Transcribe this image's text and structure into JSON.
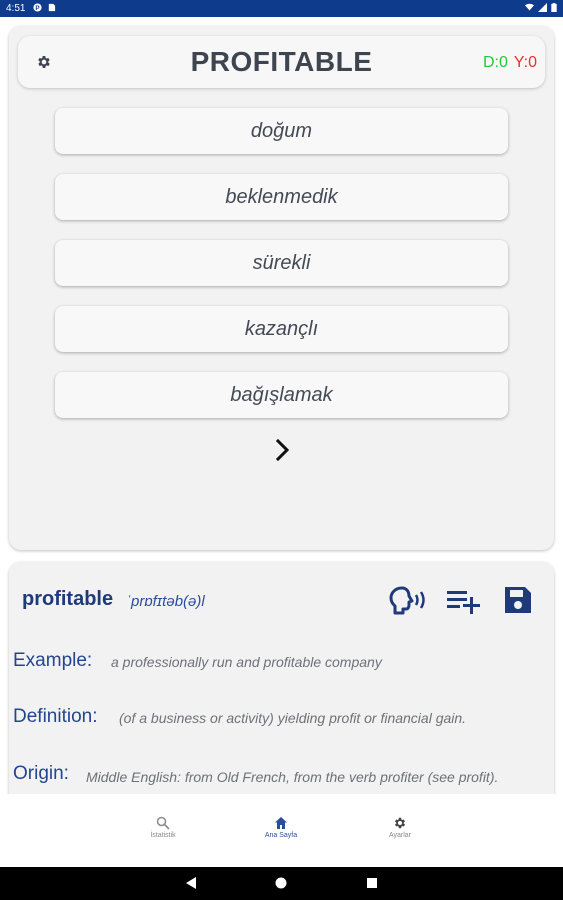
{
  "status_bar": {
    "time": "4:51"
  },
  "quiz": {
    "word": "PROFITABLE",
    "score_correct": "D:0",
    "score_wrong": "Y:0",
    "options": [
      "doğum",
      "beklenmedik",
      "sürekli",
      "kazançlı",
      "bağışlamak"
    ]
  },
  "detail": {
    "word": "profitable",
    "phonetic": "ˈprɒfɪtəb(ə)l",
    "example_label": "Example:",
    "example_text": "a professionally run and profitable company",
    "definition_label": "Definition:",
    "definition_text": "(of a business or activity) yielding profit or financial gain.",
    "origin_label": "Origin:",
    "origin_text": "Middle English: from Old French, from the verb profiter (see profit)."
  },
  "bottom_nav": {
    "items": [
      {
        "label": "İstatistik",
        "icon": "search-icon"
      },
      {
        "label": "Ana Sayfa",
        "icon": "home-icon"
      },
      {
        "label": "Ayarlar",
        "icon": "gear-icon"
      }
    ]
  },
  "colors": {
    "status_bar": "#0f3b8c",
    "accent": "#1f3a78",
    "correct": "#25c93a",
    "wrong": "#ea2f2f"
  }
}
